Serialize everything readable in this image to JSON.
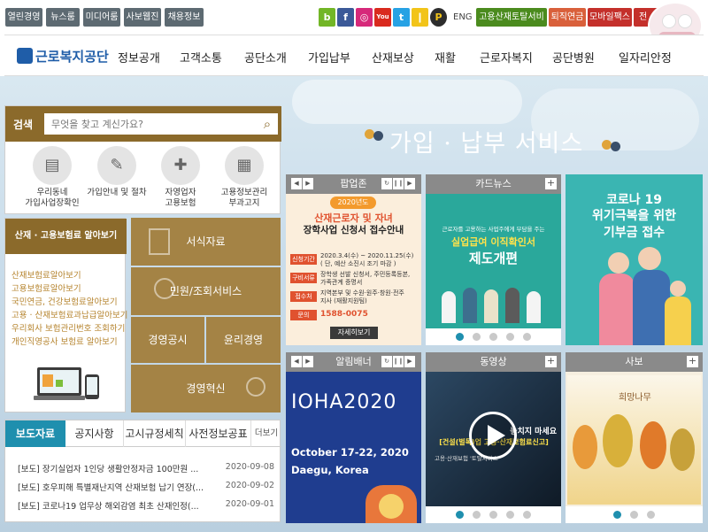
{
  "topbar": {
    "util": [
      "열린경영",
      "뉴스룸",
      "미디어룸",
      "사보웹진",
      "채용정보"
    ],
    "sns": [
      "b",
      "f",
      "◎",
      "You",
      "t",
      "❙",
      "P"
    ],
    "eng": "ENG",
    "tags": [
      "고용산재토탈서비스",
      "퇴직연금",
      "모바일팩스",
      "전"
    ]
  },
  "gnb": {
    "logo": "근로복지공단",
    "menu": [
      "정보공개",
      "고객소통",
      "공단소개",
      "가입납부",
      "산재보상",
      "재활",
      "근로자복지",
      "공단병원",
      "일자리안정"
    ]
  },
  "search": {
    "label": "검색",
    "placeholder": "무엇을 찾고 계신가요?",
    "quick": [
      {
        "label": "우리동네\n가입사업장확인"
      },
      {
        "label": "가입안내 및 절차"
      },
      {
        "label": "자영업자\n고용보험"
      },
      {
        "label": "고용정보관리\n부과고지"
      }
    ]
  },
  "insurance": {
    "title": "산재 · 고용보험료 알아보기",
    "links": [
      "산재보험료알아보기",
      "고용보험료알아보기",
      "국민연금, 건강보험료알아보기",
      "고용 · 산재보험료과납급알아보기",
      "우리회사 보험관리번호 조회하기",
      "개인직영공사 보험료 알아보기"
    ]
  },
  "tiles": {
    "forms": "서식자료",
    "civil": "민원/조회서비스",
    "mgmt": "경영공시",
    "ethics": "윤리경영",
    "innovation": "경영혁신"
  },
  "news": {
    "tabs": [
      "보도자료",
      "공지사항",
      "고시규정세칙",
      "사전정보공표"
    ],
    "more": "더보기",
    "items": [
      {
        "title": "[보도] 장기실업자 1인당 생활안정자금 100만원 ...",
        "date": "2020-09-08"
      },
      {
        "title": "[보도] 호우피해 특별재난지역 산재보험 납기 연장(...",
        "date": "2020-09-02"
      },
      {
        "title": "[보도] 코로나19 업무상 해외감염 최초 산재인정(...",
        "date": "2020-09-01"
      }
    ]
  },
  "section_title": "가입 · 납부 서비스",
  "cards": {
    "popup": {
      "head": "팝업존",
      "year": "2020년도",
      "title1": "산재근로자 및 자녀",
      "title2": "장학사업 신청서 접수안내",
      "rows": [
        {
          "k": "신청기간",
          "v": "2020.3.4(수) ~ 2020.11.25(수)\n( 단, 예산 소진시 조기 마감 )"
        },
        {
          "k": "구비서류",
          "v": "장학생 선발 신청서, 주민등록등본,\n가족관계 증명서"
        },
        {
          "k": "접수처",
          "v": "지역본부 및 수원·원주·창원·전주\n지사 (재활지원팀)"
        },
        {
          "k": "문의",
          "v": "1588-0075"
        }
      ],
      "button": "자세히보기"
    },
    "cardnews": {
      "head": "카드뉴스",
      "small": "근로자를 고용하는 사업주에게 부담을 주는",
      "title1": "실업급여 이직확인서",
      "title2": "제도개편"
    },
    "covid": {
      "line1": "코로나 19",
      "line2": "위기극복을 위한",
      "line3": "기부금 접수"
    },
    "banner": {
      "head": "알림배너",
      "logo": "IOHA2020",
      "line1": "October 17-22, 2020",
      "line2": "Daegu, Korea"
    },
    "video": {
      "head": "동영상",
      "cap1": "놓치지 마세요",
      "cap2": "[건설(벌목)업 고용·산재보험료신고]",
      "cap3": "고용·산재보험 '토탈서비스'"
    },
    "sabo": {
      "head": "사보",
      "title": "희망나무"
    }
  },
  "colors": {
    "brown": "#8b6a2b",
    "tile": "#a48345",
    "accent": "#1f8fae",
    "navy": "#1f5da8"
  }
}
